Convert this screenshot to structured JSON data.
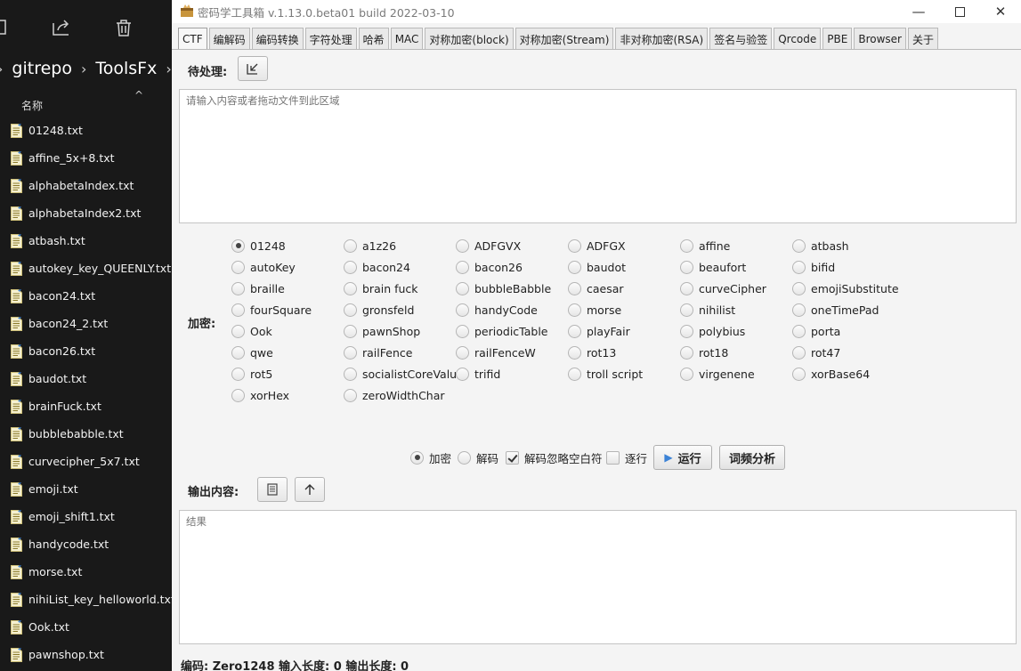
{
  "explorer": {
    "path": [
      "gitrepo",
      "ToolsFx"
    ],
    "column_name": "名称",
    "files": [
      "01248.txt",
      "affine_5x+8.txt",
      "alphabetaIndex.txt",
      "alphabetaIndex2.txt",
      "atbash.txt",
      "autokey_key_QUEENLY.txt",
      "bacon24.txt",
      "bacon24_2.txt",
      "bacon26.txt",
      "baudot.txt",
      "brainFuck.txt",
      "bubblebabble.txt",
      "curvecipher_5x7.txt",
      "emoji.txt",
      "emoji_shift1.txt",
      "handycode.txt",
      "morse.txt",
      "nihiList_key_helloworld.txt",
      "Ook.txt",
      "pawnshop.txt"
    ]
  },
  "window": {
    "title": "密码学工具箱 v.1.13.0.beta01 build 2022-03-10"
  },
  "tabs": [
    "CTF",
    "编解码",
    "编码转换",
    "字符处理",
    "哈希",
    "MAC",
    "对称加密(block)",
    "对称加密(Stream)",
    "非对称加密(RSA)",
    "签名与验签",
    "Qrcode",
    "PBE",
    "Browser",
    "关于"
  ],
  "input": {
    "label": "待处理:",
    "placeholder": "请输入内容或者拖动文件到此区域"
  },
  "encrypt": {
    "label": "加密:",
    "options": [
      [
        "01248",
        "a1z26",
        "ADFGVX",
        "ADFGX",
        "affine",
        "atbash"
      ],
      [
        "autoKey",
        "bacon24",
        "bacon26",
        "baudot",
        "beaufort",
        "bifid"
      ],
      [
        "braille",
        "brain fuck",
        "bubbleBabble",
        "caesar",
        "curveCipher",
        "emojiSubstitute"
      ],
      [
        "fourSquare",
        "gronsfeld",
        "handyCode",
        "morse",
        "nihilist",
        "oneTimePad"
      ],
      [
        "Ook",
        "pawnShop",
        "periodicTable",
        "playFair",
        "polybius",
        "porta"
      ],
      [
        "qwe",
        "railFence",
        "railFenceW",
        "rot13",
        "rot18",
        "rot47"
      ],
      [
        "rot5",
        "socialistCoreValue",
        "trifid",
        "troll script",
        "virgenene",
        "xorBase64"
      ],
      [
        "xorHex",
        "zeroWidthChar"
      ]
    ],
    "selected": "01248"
  },
  "controls": {
    "encrypt_label": "加密",
    "decrypt_label": "解码",
    "ignore_space_label": "解码忽略空白符",
    "ignore_space_checked": true,
    "line_by_line_label": "逐行",
    "line_by_line_checked": false,
    "run_label": "运行",
    "freq_label": "词频分析",
    "mode_selected": "加密"
  },
  "output": {
    "label": "输出内容:",
    "placeholder": "结果"
  },
  "status": {
    "text": "编码: Zero1248   输入长度: 0   输出长度: 0"
  },
  "colors": {
    "accent_blue": "#3b82d6",
    "explorer_bg": "#191919"
  }
}
